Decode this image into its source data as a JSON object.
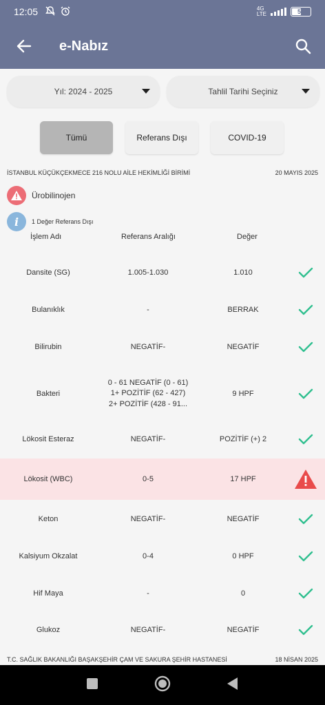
{
  "status_bar": {
    "time": "12:05",
    "network": "4G",
    "lte": "LTE",
    "battery": "55"
  },
  "app_bar": {
    "title": "e-Nabız"
  },
  "filters": {
    "year": "Yıl: 2024 - 2025",
    "date": "Tahlil Tarihi Seçiniz"
  },
  "tabs": [
    {
      "label": "Tümü",
      "active": true
    },
    {
      "label": "Referans Dışı",
      "active": false
    },
    {
      "label": "COVID-19",
      "active": false
    }
  ],
  "lab": {
    "name": "İSTANBUL KÜÇÜKÇEKMECE 216 NOLU AİLE HEKİMLİĞİ BİRİMİ",
    "date": "20 MAYIS 2025"
  },
  "flags": {
    "test_name": "Ürobilinojen",
    "out_of_range": "1 Değer Referans Dışı"
  },
  "table": {
    "headers": [
      "İşlem Adı",
      "Referans Aralığı",
      "Değer"
    ],
    "rows": [
      {
        "name": "Dansite (SG)",
        "ref": "1.005-1.030",
        "value": "1.010",
        "status": "ok"
      },
      {
        "name": "Bulanıklık",
        "ref": "-",
        "value": "BERRAK",
        "status": "ok"
      },
      {
        "name": "Bilirubin",
        "ref": "NEGATİF-",
        "value": "NEGATİF",
        "status": "ok"
      },
      {
        "name": "Bakteri",
        "ref_lines": [
          "0 - 61     NEGATİF (0 - 61)",
          "1+ POZİTİF  (62 - 427)",
          "2+ POZİTİF  (428 - 91..."
        ],
        "value": "9 HPF",
        "status": "ok"
      },
      {
        "name": "Lökosit Esteraz",
        "ref": "NEGATİF-",
        "value": "POZİTİF (+) 2",
        "status": "ok"
      },
      {
        "name": "Lökosit (WBC)",
        "ref": "0-5",
        "value": "17 HPF",
        "status": "warning"
      },
      {
        "name": "Keton",
        "ref": "NEGATİF-",
        "value": "NEGATİF",
        "status": "ok"
      },
      {
        "name": "Kalsiyum Okzalat",
        "ref": "0-4",
        "value": "0 HPF",
        "status": "ok"
      },
      {
        "name": "Hif Maya",
        "ref": "-",
        "value": "0",
        "status": "ok"
      },
      {
        "name": "Glukoz",
        "ref": "NEGATİF-",
        "value": "NEGATİF",
        "status": "ok"
      }
    ]
  },
  "next_lab": {
    "name": "T.C. SAĞLIK BAKANLIĞI BAŞAKŞEHİR ÇAM VE SAKURA ŞEHİR HASTANESİ",
    "date": "18 NİSAN 2025"
  },
  "colors": {
    "appbar": "#6b7596",
    "ok_check": "#2fbf8f",
    "warning": "#e94b4b",
    "flag_row_bg": "#fbe3e5"
  }
}
